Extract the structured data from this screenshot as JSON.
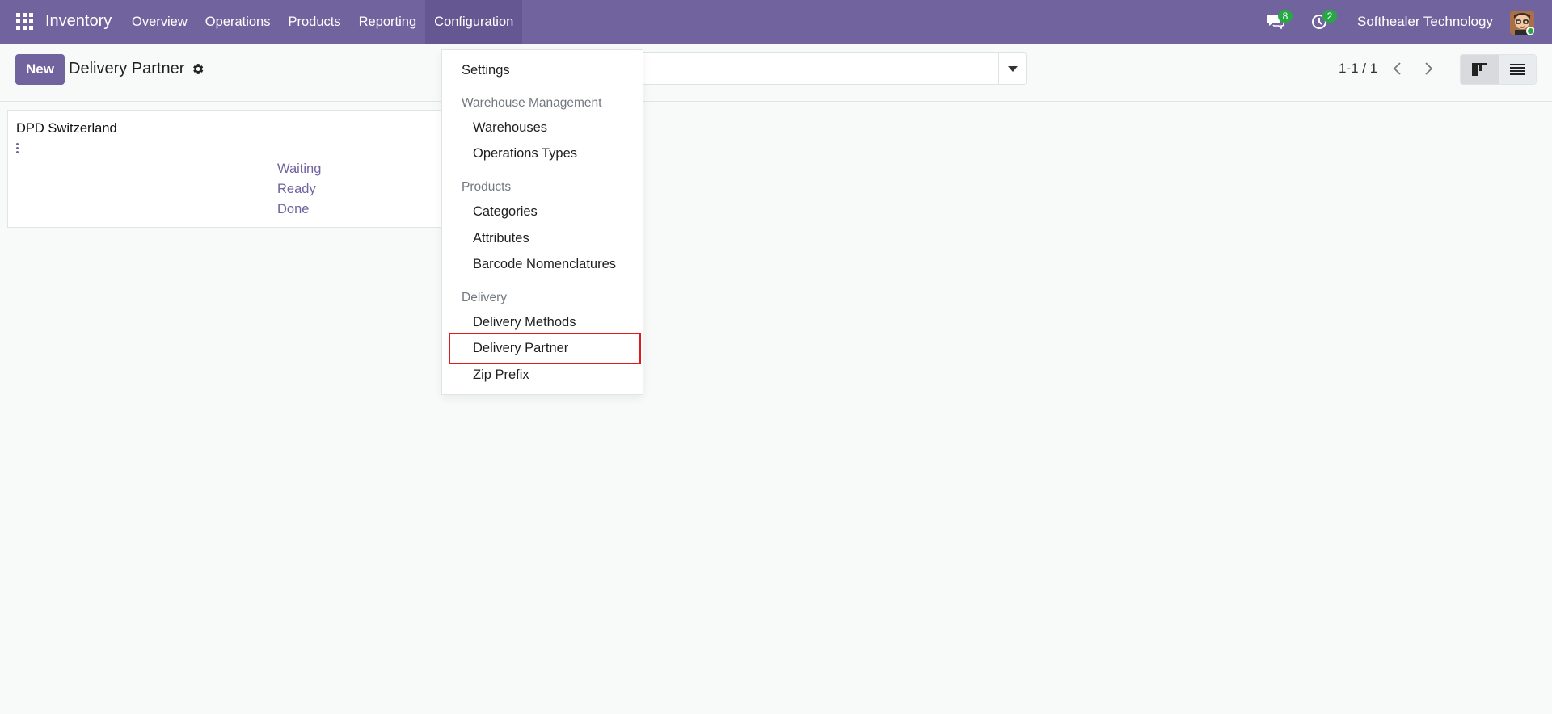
{
  "app": {
    "name": "Inventory"
  },
  "navbar": {
    "menu": [
      "Overview",
      "Operations",
      "Products",
      "Reporting",
      "Configuration"
    ],
    "active_menu": "Configuration",
    "messages_count": "8",
    "activities_count": "2",
    "company": "Softhealer Technology",
    "icons": [
      "apps-grid-icon",
      "chat-icon",
      "clock-icon",
      "avatar"
    ]
  },
  "control_panel": {
    "new_label": "New",
    "title": "Delivery Partner",
    "pager": "1-1 / 1",
    "views": [
      "kanban",
      "list"
    ],
    "active_view": "kanban"
  },
  "kanban": {
    "records": [
      {
        "name": "DPD Switzerland",
        "links": [
          "Waiting",
          "Ready",
          "Done"
        ]
      }
    ]
  },
  "dropdown": {
    "settings": "Settings",
    "sections": [
      {
        "header": "Warehouse Management",
        "items": [
          "Warehouses",
          "Operations Types"
        ]
      },
      {
        "header": "Products",
        "items": [
          "Categories",
          "Attributes",
          "Barcode Nomenclatures"
        ]
      },
      {
        "header": "Delivery",
        "items": [
          "Delivery Methods",
          "Delivery Partner",
          "Zip Prefix"
        ]
      }
    ],
    "highlighted_item": "Delivery Partner",
    "highlight_color": "#e01b1b"
  },
  "colors": {
    "navbar": "#71639e",
    "primary_button": "#71639e",
    "link": "#71639e",
    "badge": "#28a745",
    "background": "#f8f9f9"
  }
}
